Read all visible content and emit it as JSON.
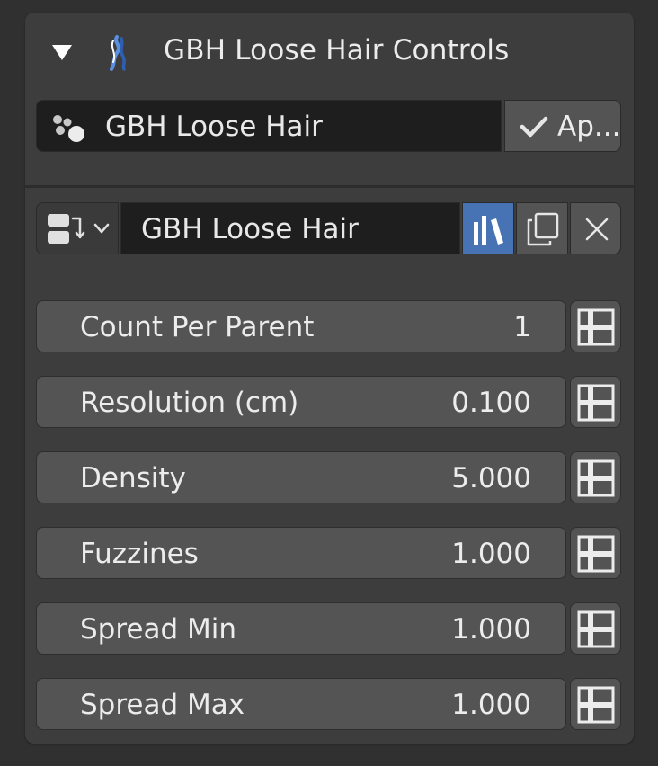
{
  "panel": {
    "title": "GBH Loose Hair Controls",
    "collapse_icon": "triangle-down-icon",
    "header_icon": "hair-strand-icon"
  },
  "datablock": {
    "name": "GBH Loose Hair",
    "icon": "particles-icon",
    "apply_label": "Ap...",
    "apply_icon": "checkmark-icon"
  },
  "settings": {
    "browse_icon": "particle-settings-icon",
    "name": "GBH Loose Hair",
    "fake_user_icon": "fake-user-icon",
    "duplicate_icon": "duplicate-icon",
    "unlink_icon": "close-icon"
  },
  "properties": [
    {
      "label": "Count Per Parent",
      "value": "1"
    },
    {
      "label": "Resolution (cm)",
      "value": "0.100"
    },
    {
      "label": "Density",
      "value": "5.000"
    },
    {
      "label": "Fuzzines",
      "value": "1.000"
    },
    {
      "label": "Spread Min",
      "value": "1.000"
    },
    {
      "label": "Spread Max",
      "value": "1.000"
    }
  ],
  "colors": {
    "accent": "#4772b3",
    "panel_bg": "#3d3d3d",
    "field_dark": "#1e1e1e",
    "button": "#545454"
  }
}
